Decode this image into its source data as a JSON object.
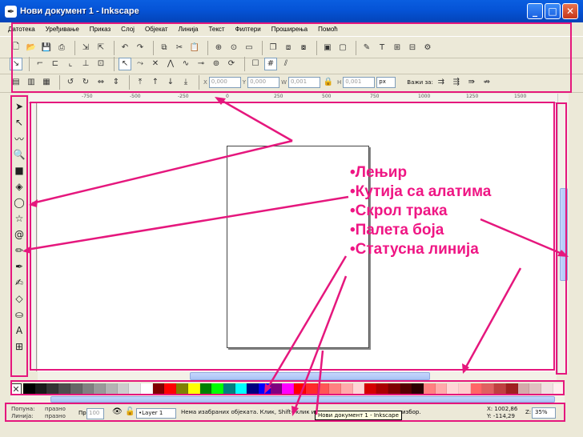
{
  "window": {
    "title": "Нови документ 1 - Inkscape",
    "buttons": {
      "minimize": "_",
      "maximize": "□",
      "close": "✕"
    }
  },
  "menu": [
    "Датотека",
    "Уређивање",
    "Приказ",
    "Слој",
    "Објекат",
    "Линија",
    "Текст",
    "Филтери",
    "Проширења",
    "Помоћ"
  ],
  "toolcontrols": {
    "x_label": "X",
    "x_value": "0,000",
    "y_label": "Y",
    "y_value": "0,000",
    "w_label": "W",
    "w_value": "0,001",
    "h_label": "H",
    "h_value": "0,001",
    "unit": "px",
    "affect_label": "Важи за:"
  },
  "rulers": {
    "top_ticks": [
      "-750",
      "-500",
      "-250",
      "0",
      "250",
      "500",
      "750",
      "1000",
      "1250",
      "1500"
    ]
  },
  "statusbar": {
    "fill_label": "Попуна:",
    "stroke_label": "Линија:",
    "fill_value": "празно",
    "stroke_value": "празно",
    "opacity_label": "Пр",
    "opacity_value": "100",
    "layer": "•Layer 1",
    "message": "Нема изабраних објеката. Клик, Shift+клик или",
    "message_end": "избор.",
    "tooltip": "Нови документ 1 - Inkscape",
    "x_coord": "X: 1002,86",
    "y_coord": "Y: -114,29",
    "zoom_label": "Z:",
    "zoom": "35%"
  },
  "annotations": {
    "items": [
      "•Лењир",
      "•Кутија са алатима",
      "•Скрол трака",
      "•Палета боја",
      "•Статусна линија"
    ],
    "color": "#e5177d"
  },
  "palette_colors": [
    "#000000",
    "#1a1a1a",
    "#333333",
    "#4d4d4d",
    "#666666",
    "#808080",
    "#999999",
    "#b3b3b3",
    "#cccccc",
    "#e6e6e6",
    "#ffffff",
    "#800000",
    "#ff0000",
    "#808000",
    "#ffff00",
    "#008000",
    "#00ff00",
    "#008080",
    "#00ffff",
    "#000080",
    "#0000ff",
    "#800080",
    "#ff00ff",
    "#ff0000",
    "#ff2a2a",
    "#ff5555",
    "#ff8080",
    "#ffaaaa",
    "#ffd5d5",
    "#d40000",
    "#aa0000",
    "#800000",
    "#550000",
    "#2b0000",
    "#ff8080",
    "#ffaaaa",
    "#ffd5d5",
    "#ffcccc",
    "#ff6666",
    "#e06060",
    "#c04040",
    "#a02020",
    "#d4aaaa",
    "#e0c0c0",
    "#f0e0e0",
    "#ffeeee"
  ]
}
